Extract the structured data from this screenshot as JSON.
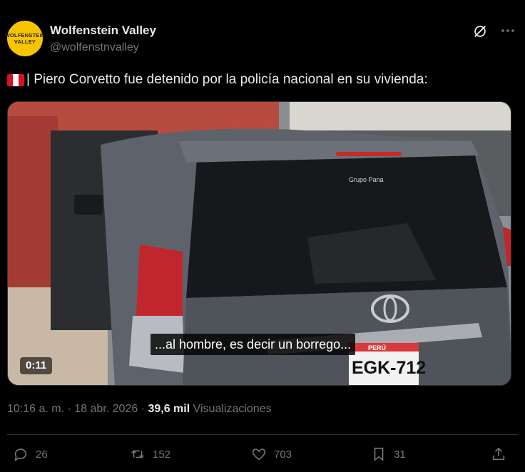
{
  "author": {
    "name": "Wolfenstein Valley",
    "handle": "@wolfenstnvalley",
    "avatar_line1": "WOLFENSTEIN",
    "avatar_line2": "VALLEY"
  },
  "tweet": {
    "text": "| Piero Corvetto fue detenido por la policía nacional en su vivienda:"
  },
  "video": {
    "subtitle": "...al hombre, es decir un borrego...",
    "duration": "0:11",
    "dealer_label": "Grupo Pana",
    "plate": "EGK-712",
    "plate_country": "PERÚ"
  },
  "meta": {
    "time": "10:16 a. m. · 18 abr. 2026 · ",
    "views": "39,6 mil",
    "views_label": "Visualizaciones"
  },
  "actions": {
    "replies": "26",
    "reposts": "152",
    "likes": "703",
    "bookmarks": "31"
  },
  "colors": {
    "background": "#000000",
    "text": "#e7e9ea",
    "muted": "#71767b",
    "border": "#2f3336",
    "avatar": "#f6c400",
    "flag_red": "#d91023"
  }
}
